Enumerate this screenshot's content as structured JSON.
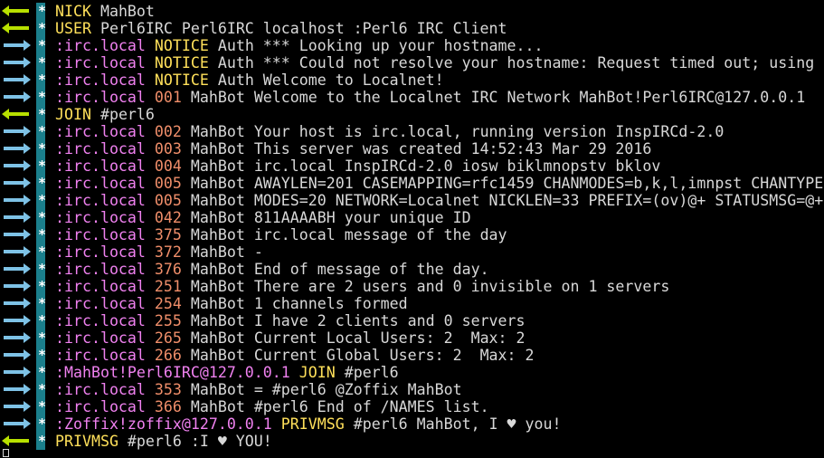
{
  "terminal": {
    "colors": {
      "background": "#000000",
      "gutter": "#1b7f8c",
      "outgoing_arrow": "#b8e000",
      "incoming_arrow": "#7ec2e6",
      "source": "#f081f0",
      "command": "#ffe05a",
      "numeric": "#f08e6a",
      "text": "#d8d8d8"
    },
    "gutter_marker": "*",
    "lines": [
      {
        "dir": "out",
        "parts": [
          {
            "t": "cmd",
            "v": "NICK"
          },
          {
            "t": "plain",
            "v": " MahBot"
          }
        ]
      },
      {
        "dir": "out",
        "parts": [
          {
            "t": "cmd",
            "v": "USER"
          },
          {
            "t": "plain",
            "v": " Perl6IRC Perl6IRC localhost :Perl6 IRC Client"
          }
        ]
      },
      {
        "dir": "in",
        "parts": [
          {
            "t": "src",
            "v": ":irc.local"
          },
          {
            "t": "plain",
            "v": " "
          },
          {
            "t": "cmd",
            "v": "NOTICE"
          },
          {
            "t": "plain",
            "v": " Auth *** Looking up your hostname..."
          }
        ]
      },
      {
        "dir": "in",
        "parts": [
          {
            "t": "src",
            "v": ":irc.local"
          },
          {
            "t": "plain",
            "v": " "
          },
          {
            "t": "cmd",
            "v": "NOTICE"
          },
          {
            "t": "plain",
            "v": " Auth *** Could not resolve your hostname: Request timed out; using"
          }
        ]
      },
      {
        "dir": "in",
        "parts": [
          {
            "t": "src",
            "v": ":irc.local"
          },
          {
            "t": "plain",
            "v": " "
          },
          {
            "t": "cmd",
            "v": "NOTICE"
          },
          {
            "t": "plain",
            "v": " Auth Welcome to Localnet!"
          }
        ]
      },
      {
        "dir": "in",
        "parts": [
          {
            "t": "src",
            "v": ":irc.local"
          },
          {
            "t": "plain",
            "v": " "
          },
          {
            "t": "num",
            "v": "001"
          },
          {
            "t": "plain",
            "v": " MahBot Welcome to the Localnet IRC Network MahBot!Perl6IRC@127.0.0.1"
          }
        ]
      },
      {
        "dir": "out",
        "parts": [
          {
            "t": "cmd",
            "v": "JOIN"
          },
          {
            "t": "plain",
            "v": " #perl6"
          }
        ]
      },
      {
        "dir": "in",
        "parts": [
          {
            "t": "src",
            "v": ":irc.local"
          },
          {
            "t": "plain",
            "v": " "
          },
          {
            "t": "num",
            "v": "002"
          },
          {
            "t": "plain",
            "v": " MahBot Your host is irc.local, running version InspIRCd-2.0"
          }
        ]
      },
      {
        "dir": "in",
        "parts": [
          {
            "t": "src",
            "v": ":irc.local"
          },
          {
            "t": "plain",
            "v": " "
          },
          {
            "t": "num",
            "v": "003"
          },
          {
            "t": "plain",
            "v": " MahBot This server was created 14:52:43 Mar 29 2016"
          }
        ]
      },
      {
        "dir": "in",
        "parts": [
          {
            "t": "src",
            "v": ":irc.local"
          },
          {
            "t": "plain",
            "v": " "
          },
          {
            "t": "num",
            "v": "004"
          },
          {
            "t": "plain",
            "v": " MahBot irc.local InspIRCd-2.0 iosw biklmnopstv bklov"
          }
        ]
      },
      {
        "dir": "in",
        "parts": [
          {
            "t": "src",
            "v": ":irc.local"
          },
          {
            "t": "plain",
            "v": " "
          },
          {
            "t": "num",
            "v": "005"
          },
          {
            "t": "plain",
            "v": " MahBot AWAYLEN=201 CASEMAPPING=rfc1459 CHANMODES=b,k,l,imnpst CHANTYPE"
          }
        ]
      },
      {
        "dir": "in",
        "parts": [
          {
            "t": "src",
            "v": ":irc.local"
          },
          {
            "t": "plain",
            "v": " "
          },
          {
            "t": "num",
            "v": "005"
          },
          {
            "t": "plain",
            "v": " MahBot MODES=20 NETWORK=Localnet NICKLEN=33 PREFIX=(ov)@+ STATUSMSG=@+"
          }
        ]
      },
      {
        "dir": "in",
        "parts": [
          {
            "t": "src",
            "v": ":irc.local"
          },
          {
            "t": "plain",
            "v": " "
          },
          {
            "t": "num",
            "v": "042"
          },
          {
            "t": "plain",
            "v": " MahBot 811AAAABH your unique ID"
          }
        ]
      },
      {
        "dir": "in",
        "parts": [
          {
            "t": "src",
            "v": ":irc.local"
          },
          {
            "t": "plain",
            "v": " "
          },
          {
            "t": "num",
            "v": "375"
          },
          {
            "t": "plain",
            "v": " MahBot irc.local message of the day"
          }
        ]
      },
      {
        "dir": "in",
        "parts": [
          {
            "t": "src",
            "v": ":irc.local"
          },
          {
            "t": "plain",
            "v": " "
          },
          {
            "t": "num",
            "v": "372"
          },
          {
            "t": "plain",
            "v": " MahBot -"
          }
        ]
      },
      {
        "dir": "in",
        "parts": [
          {
            "t": "src",
            "v": ":irc.local"
          },
          {
            "t": "plain",
            "v": " "
          },
          {
            "t": "num",
            "v": "376"
          },
          {
            "t": "plain",
            "v": " MahBot End of message of the day."
          }
        ]
      },
      {
        "dir": "in",
        "parts": [
          {
            "t": "src",
            "v": ":irc.local"
          },
          {
            "t": "plain",
            "v": " "
          },
          {
            "t": "num",
            "v": "251"
          },
          {
            "t": "plain",
            "v": " MahBot There are 2 users and 0 invisible on 1 servers"
          }
        ]
      },
      {
        "dir": "in",
        "parts": [
          {
            "t": "src",
            "v": ":irc.local"
          },
          {
            "t": "plain",
            "v": " "
          },
          {
            "t": "num",
            "v": "254"
          },
          {
            "t": "plain",
            "v": " MahBot 1 channels formed"
          }
        ]
      },
      {
        "dir": "in",
        "parts": [
          {
            "t": "src",
            "v": ":irc.local"
          },
          {
            "t": "plain",
            "v": " "
          },
          {
            "t": "num",
            "v": "255"
          },
          {
            "t": "plain",
            "v": " MahBot I have 2 clients and 0 servers"
          }
        ]
      },
      {
        "dir": "in",
        "parts": [
          {
            "t": "src",
            "v": ":irc.local"
          },
          {
            "t": "plain",
            "v": " "
          },
          {
            "t": "num",
            "v": "265"
          },
          {
            "t": "plain",
            "v": " MahBot Current Local Users: 2  Max: 2"
          }
        ]
      },
      {
        "dir": "in",
        "parts": [
          {
            "t": "src",
            "v": ":irc.local"
          },
          {
            "t": "plain",
            "v": " "
          },
          {
            "t": "num",
            "v": "266"
          },
          {
            "t": "plain",
            "v": " MahBot Current Global Users: 2  Max: 2"
          }
        ]
      },
      {
        "dir": "in",
        "parts": [
          {
            "t": "src",
            "v": ":MahBot!Perl6IRC@127.0.0.1"
          },
          {
            "t": "plain",
            "v": " "
          },
          {
            "t": "cmd",
            "v": "JOIN"
          },
          {
            "t": "plain",
            "v": " #perl6"
          }
        ]
      },
      {
        "dir": "in",
        "parts": [
          {
            "t": "src",
            "v": ":irc.local"
          },
          {
            "t": "plain",
            "v": " "
          },
          {
            "t": "num",
            "v": "353"
          },
          {
            "t": "plain",
            "v": " MahBot = #perl6 @Zoffix MahBot"
          }
        ]
      },
      {
        "dir": "in",
        "parts": [
          {
            "t": "src",
            "v": ":irc.local"
          },
          {
            "t": "plain",
            "v": " "
          },
          {
            "t": "num",
            "v": "366"
          },
          {
            "t": "plain",
            "v": " MahBot #perl6 End of /NAMES list."
          }
        ]
      },
      {
        "dir": "in",
        "parts": [
          {
            "t": "src",
            "v": ":Zoffix!zoffix@127.0.0.1"
          },
          {
            "t": "plain",
            "v": " "
          },
          {
            "t": "cmd",
            "v": "PRIVMSG"
          },
          {
            "t": "plain",
            "v": " #perl6 MahBot, I ♥ you!"
          }
        ]
      },
      {
        "dir": "out",
        "parts": [
          {
            "t": "cmd",
            "v": "PRIVMSG"
          },
          {
            "t": "plain",
            "v": " #perl6 :I ♥ YOU!"
          }
        ]
      }
    ]
  }
}
